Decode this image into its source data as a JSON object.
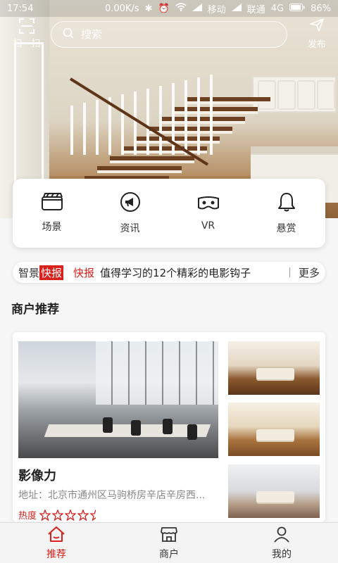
{
  "status_bar": {
    "time": "17:54",
    "speed": "0.00K/s",
    "carrier1": "移动",
    "carrier2": "联通",
    "network": "4G",
    "battery": "86%"
  },
  "header": {
    "scan_label": "扫一扫",
    "search_placeholder": "搜索",
    "publish_label": "发布"
  },
  "categories": [
    {
      "label": "场景",
      "icon": "clapperboard-icon"
    },
    {
      "label": "资讯",
      "icon": "megaphone-icon"
    },
    {
      "label": "VR",
      "icon": "vr-goggles-icon"
    },
    {
      "label": "悬赏",
      "icon": "bell-icon"
    }
  ],
  "ticker": {
    "brand_part1": "智景",
    "brand_part2": "快报",
    "tag": "快报",
    "headline": "值得学习的12个精彩的电影钩子",
    "more": "更多"
  },
  "section": {
    "title": "商户推荐"
  },
  "merchant": {
    "name": "影像力",
    "address": "地址：北京市通州区马驹桥房辛店辛房西...",
    "heat_label": "热度",
    "rating": 4.5,
    "rating_max": 5
  },
  "bottom_nav": [
    {
      "label": "推荐",
      "icon": "home-icon",
      "active": true
    },
    {
      "label": "商户",
      "icon": "shop-icon",
      "active": false
    },
    {
      "label": "我的",
      "icon": "user-icon",
      "active": false
    }
  ],
  "colors": {
    "accent": "#d9201c",
    "card_bg": "#ffffff",
    "page_bg": "#f6f6f6"
  }
}
